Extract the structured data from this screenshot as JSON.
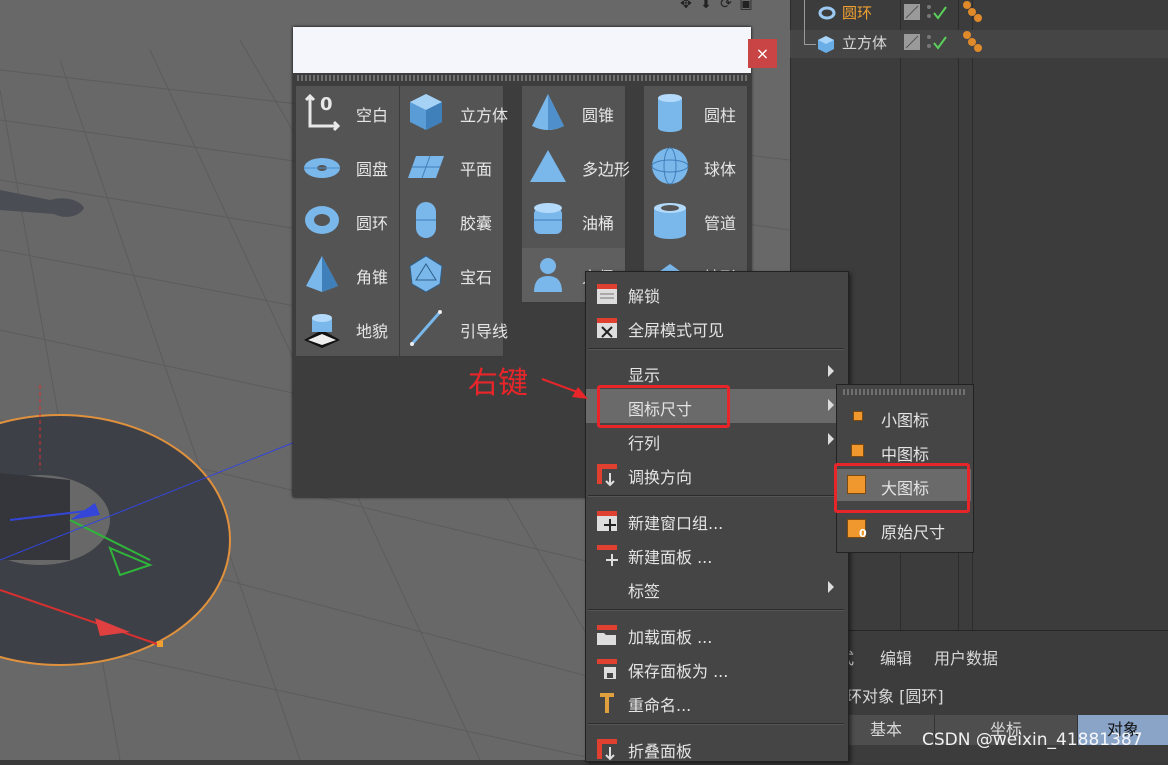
{
  "viewport": {
    "toolbar_icons": [
      "move-icon",
      "arrow-down-icon",
      "refresh-icon",
      "window-icon"
    ]
  },
  "object_manager": {
    "objects": [
      {
        "name": "圆环",
        "color": "#f0a030",
        "icon": "torus-icon"
      },
      {
        "name": "立方体",
        "color": "#d8d8d8",
        "icon": "cube-icon"
      }
    ]
  },
  "palette": {
    "close_label": "×",
    "items": [
      {
        "label": "空白",
        "icon": "null-icon"
      },
      {
        "label": "立方体",
        "icon": "cube-icon"
      },
      {
        "label": "圆锥",
        "icon": "cone-icon"
      },
      {
        "label": "圆柱",
        "icon": "cylinder-icon"
      },
      {
        "label": "圆盘",
        "icon": "disc-icon"
      },
      {
        "label": "平面",
        "icon": "plane-icon"
      },
      {
        "label": "多边形",
        "icon": "polygon-icon"
      },
      {
        "label": "球体",
        "icon": "sphere-icon"
      },
      {
        "label": "圆环",
        "icon": "torus-icon"
      },
      {
        "label": "胶囊",
        "icon": "capsule-icon"
      },
      {
        "label": "油桶",
        "icon": "oil-tank-icon"
      },
      {
        "label": "管道",
        "icon": "tube-icon"
      },
      {
        "label": "角锥",
        "icon": "pyramid-icon"
      },
      {
        "label": "宝石",
        "icon": "platonic-icon"
      },
      {
        "label": "人偶",
        "icon": "figure-icon"
      },
      {
        "label": "地形",
        "icon": "landscape-icon"
      },
      {
        "label": "地貌",
        "icon": "relief-icon"
      },
      {
        "label": "引导线",
        "icon": "guide-icon"
      }
    ]
  },
  "context_menu": {
    "items": [
      {
        "label": "解锁",
        "icon": "unlock-icon"
      },
      {
        "label": "全屏模式可见",
        "icon": "fullscreen-icon"
      },
      {
        "label": "显示",
        "submenu": true
      },
      {
        "label": "图标尺寸",
        "submenu": true
      },
      {
        "label": "行列",
        "submenu": true
      },
      {
        "label": "调换方向",
        "icon": "swap-direction-icon"
      },
      {
        "label": "新建窗口组...",
        "icon": "new-window-group-icon"
      },
      {
        "label": "新建面板 ...",
        "icon": "new-panel-icon"
      },
      {
        "label": "标签",
        "submenu": true
      },
      {
        "label": "加载面板 ...",
        "icon": "load-panel-icon"
      },
      {
        "label": "保存面板为 ...",
        "icon": "save-panel-icon"
      },
      {
        "label": "重命名...",
        "icon": "rename-icon"
      },
      {
        "label": "折叠面板",
        "icon": "fold-panel-icon"
      }
    ]
  },
  "icon_size_submenu": {
    "items": [
      {
        "label": "小图标"
      },
      {
        "label": "中图标"
      },
      {
        "label": "大图标"
      },
      {
        "label": "原始尺寸"
      }
    ]
  },
  "annotation": {
    "text": "右键",
    "color": "#e8262a"
  },
  "attribute_manager": {
    "menu": [
      "式",
      "编辑",
      "用户数据"
    ],
    "title": "环对象 [圆环]",
    "tabs": [
      "基本",
      "坐标",
      "对象"
    ]
  },
  "watermark": "CSDN @weixin_41881387"
}
